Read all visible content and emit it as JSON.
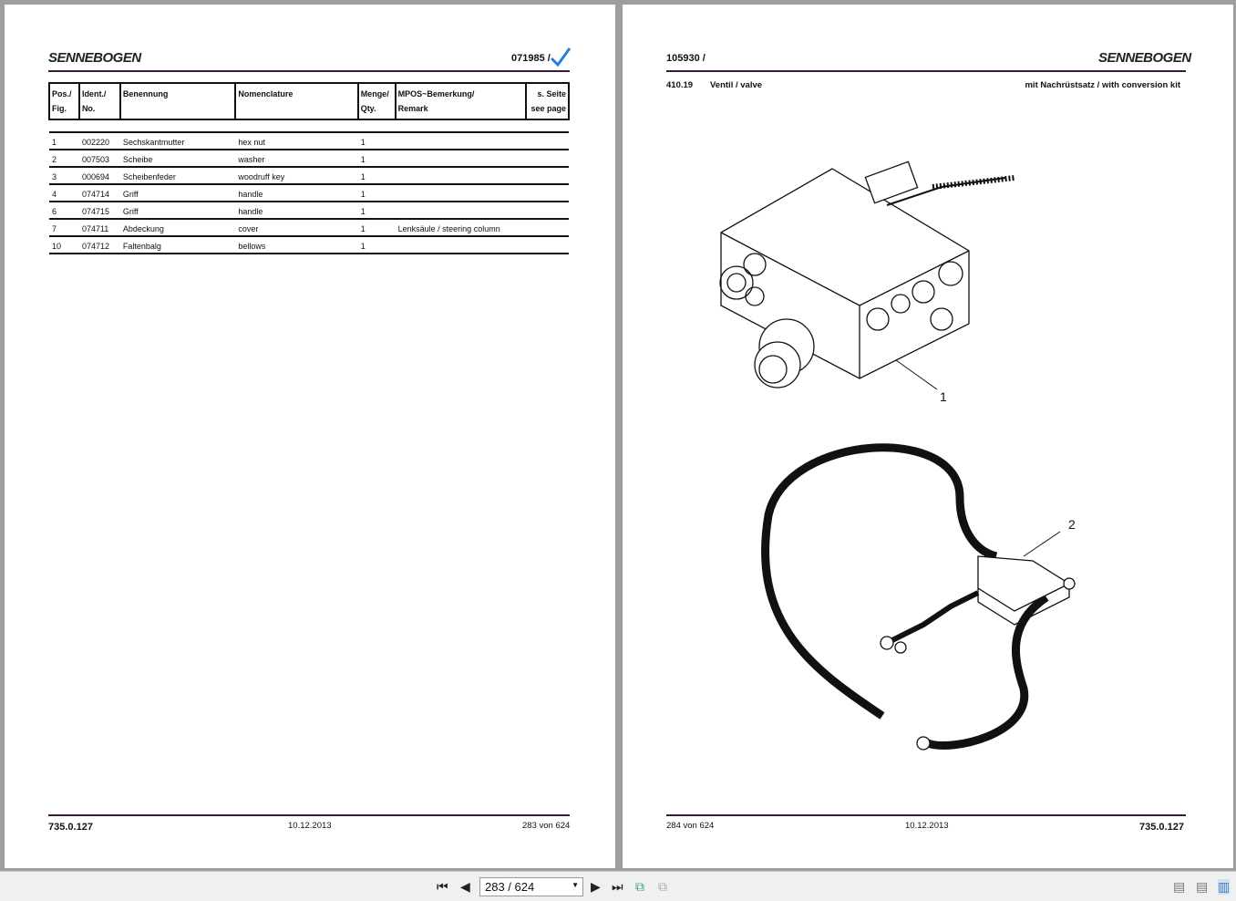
{
  "left_page": {
    "logo": "SENNEBOGEN",
    "part_number": "071985 /",
    "columns": [
      [
        "Pos./",
        "Fig."
      ],
      [
        "Ident./",
        "No."
      ],
      [
        "Benennung",
        ""
      ],
      [
        "Nomenclature",
        ""
      ],
      [
        "Menge/",
        "Qty."
      ],
      [
        "MPOS~Bemerkung/",
        "Remark"
      ],
      [
        "s. Seite",
        "see page"
      ]
    ],
    "rows": [
      [
        "1",
        "002220",
        "Sechskantmutter",
        "hex nut",
        "1",
        "",
        ""
      ],
      [
        "2",
        "007503",
        "Scheibe",
        "washer",
        "1",
        "",
        ""
      ],
      [
        "3",
        "000694",
        "Scheibenfeder",
        "woodruff key",
        "1",
        "",
        ""
      ],
      [
        "4",
        "074714",
        "Griff",
        "handle",
        "1",
        "",
        ""
      ],
      [
        "6",
        "074715",
        "Griff",
        "handle",
        "1",
        "",
        ""
      ],
      [
        "7",
        "074711",
        "Abdeckung",
        "cover",
        "1",
        "Lenksäule / steering column",
        ""
      ],
      [
        "10",
        "074712",
        "Faltenbalg",
        "bellows",
        "1",
        "",
        ""
      ]
    ],
    "footer": {
      "doc": "735.0.127",
      "date": "10.12.2013",
      "page": "283 von 624"
    }
  },
  "right_page": {
    "logo": "SENNEBOGEN",
    "part_number": "105930 /",
    "group": "410.19",
    "title": "Ventil / valve",
    "note": "mit Nachrüstsatz / with conversion kit",
    "callouts": [
      "1",
      "2"
    ],
    "footer": {
      "page": "284 von 624",
      "date": "10.12.2013",
      "doc": "735.0.127"
    }
  },
  "toolbar": {
    "page_value": "283 / 624"
  },
  "colors": {
    "rule": "#3a1a3a",
    "check": "#2a7fd4"
  }
}
